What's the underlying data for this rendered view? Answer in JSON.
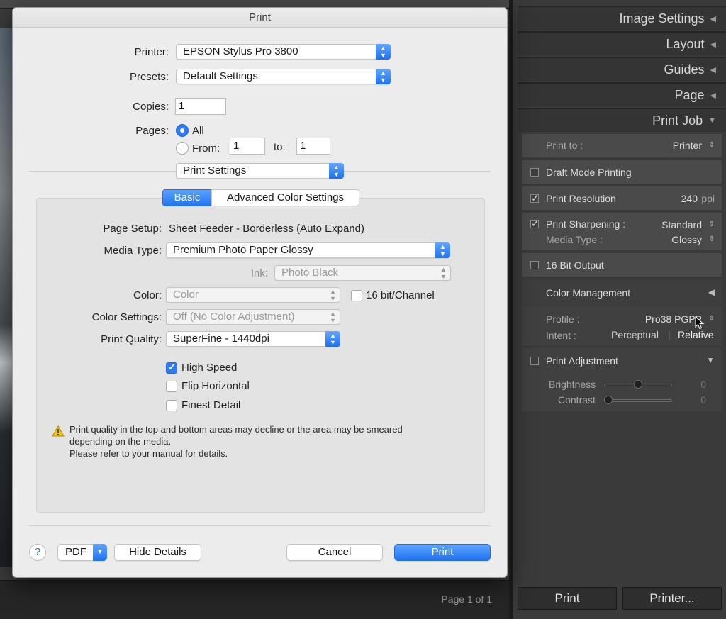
{
  "dialog": {
    "title": "Print",
    "printer_label": "Printer:",
    "printer_value": "EPSON Stylus Pro 3800",
    "presets_label": "Presets:",
    "presets_value": "Default Settings",
    "copies_label": "Copies:",
    "copies_value": "1",
    "pages_label": "Pages:",
    "pages_all": "All",
    "pages_from": "From:",
    "pages_from_value": "1",
    "pages_to": "to:",
    "pages_to_value": "1",
    "panel_select": "Print Settings",
    "tabs": [
      "Basic",
      "Advanced Color Settings"
    ],
    "page_setup_label": "Page Setup:",
    "page_setup_value": "Sheet Feeder - Borderless (Auto Expand)",
    "media_type_label": "Media Type:",
    "media_type_value": "Premium Photo Paper Glossy",
    "ink_label": "Ink:",
    "ink_value": "Photo Black",
    "color_label": "Color:",
    "color_value": "Color",
    "bit16_label": "16 bit/Channel",
    "color_settings_label": "Color Settings:",
    "color_settings_value": "Off (No Color Adjustment)",
    "print_quality_label": "Print Quality:",
    "print_quality_value": "SuperFine - 1440dpi",
    "high_speed": "High Speed",
    "flip_horizontal": "Flip Horizontal",
    "finest_detail": "Finest Detail",
    "warning_line1": "Print quality in the top and bottom areas may decline or the area may be smeared",
    "warning_line2": "depending on the media.",
    "warning_line3": "Please refer to your manual for details.",
    "help": "?",
    "pdf": "PDF",
    "hide_details": "Hide Details",
    "cancel": "Cancel",
    "print": "Print"
  },
  "right_panel": {
    "headers": [
      "Image Settings",
      "Layout",
      "Guides",
      "Page",
      "Print Job"
    ],
    "print_to_label": "Print to :",
    "print_to_value": "Printer",
    "draft_mode": "Draft Mode Printing",
    "print_resolution": "Print Resolution",
    "resolution_value": "240",
    "resolution_unit": "ppi",
    "print_sharpening": "Print Sharpening :",
    "sharpening_value": "Standard",
    "media_type_label": "Media Type :",
    "media_type_value": "Glossy",
    "bit_output": "16 Bit Output",
    "color_management": "Color Management",
    "profile_label": "Profile :",
    "profile_value": "Pro38 PGPP",
    "intent_label": "Intent :",
    "intent_perceptual": "Perceptual",
    "intent_relative": "Relative",
    "print_adjustment": "Print Adjustment",
    "brightness": "Brightness",
    "brightness_value": "0",
    "contrast": "Contrast",
    "contrast_value": "0",
    "print_button": "Print",
    "printer_button": "Printer..."
  },
  "footer": {
    "page_indicator": "Page 1 of 1"
  }
}
